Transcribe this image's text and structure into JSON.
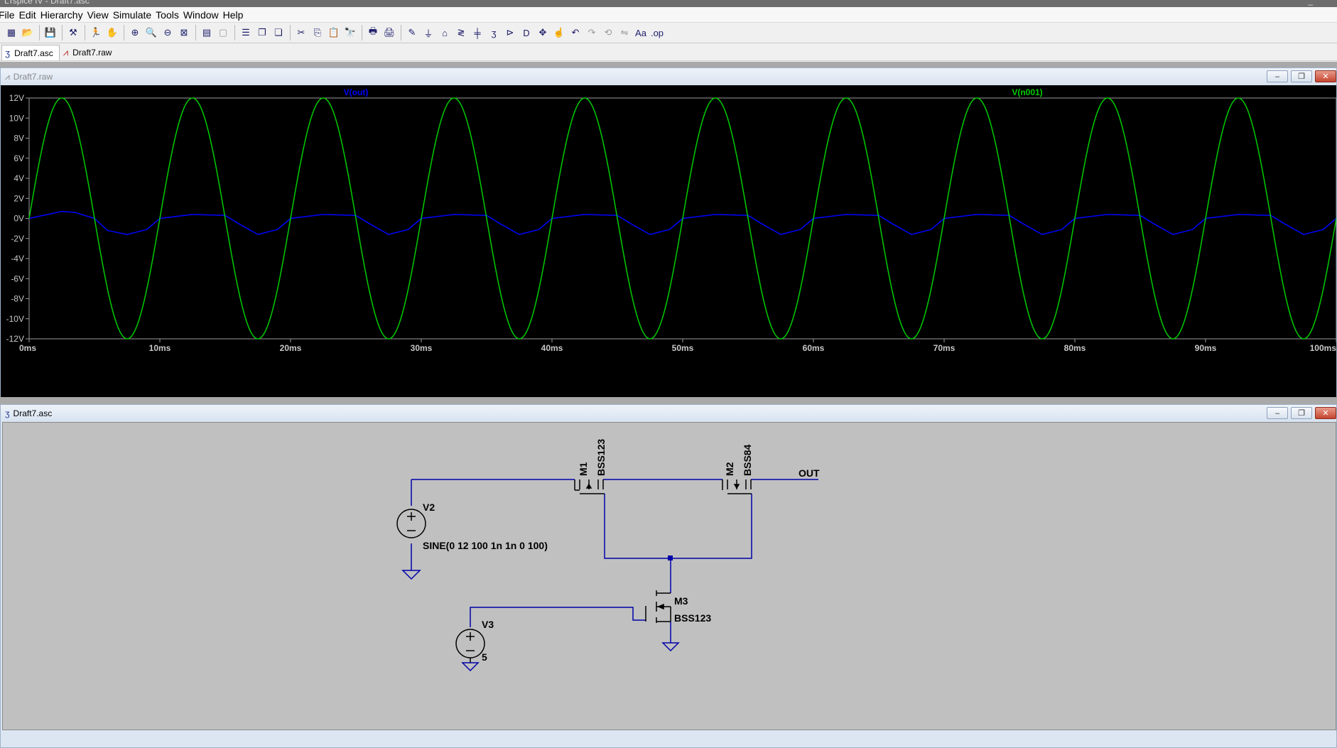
{
  "window": {
    "title": "LTspice IV - Draft7.asc",
    "min_glyph": "_"
  },
  "menu": [
    {
      "label": "File"
    },
    {
      "label": "Edit"
    },
    {
      "label": "Hierarchy"
    },
    {
      "label": "View"
    },
    {
      "label": "Simulate"
    },
    {
      "label": "Tools"
    },
    {
      "label": "Window"
    },
    {
      "label": "Help"
    }
  ],
  "toolbar": [
    {
      "icon": "new-schematic-icon",
      "glyph": "▦"
    },
    {
      "icon": "open-icon",
      "glyph": "📂"
    },
    {
      "sep": true
    },
    {
      "icon": "save-icon",
      "glyph": "💾"
    },
    {
      "sep": true
    },
    {
      "icon": "control-panel-icon",
      "glyph": "⚒"
    },
    {
      "sep": true
    },
    {
      "icon": "run-icon",
      "glyph": "🏃"
    },
    {
      "icon": "halt-icon",
      "glyph": "✋",
      "dim": true
    },
    {
      "sep": true
    },
    {
      "icon": "zoom-in-icon",
      "glyph": "⊕"
    },
    {
      "icon": "pan-icon",
      "glyph": "🔍"
    },
    {
      "icon": "zoom-out-icon",
      "glyph": "⊖"
    },
    {
      "icon": "zoom-fit-icon",
      "glyph": "⊠"
    },
    {
      "sep": true
    },
    {
      "icon": "autorange-icon",
      "glyph": "▤"
    },
    {
      "icon": "delete-traces-icon",
      "glyph": "▢",
      "dim": true
    },
    {
      "sep": true
    },
    {
      "icon": "tile-vertical-icon",
      "glyph": "☰"
    },
    {
      "icon": "cascade-icon",
      "glyph": "❐"
    },
    {
      "icon": "tile-horizontal-icon",
      "glyph": "❏"
    },
    {
      "sep": true
    },
    {
      "icon": "cut-icon",
      "glyph": "✂"
    },
    {
      "icon": "copy-icon",
      "glyph": "⎘"
    },
    {
      "icon": "paste-icon",
      "glyph": "📋"
    },
    {
      "icon": "find-icon",
      "glyph": "🔭"
    },
    {
      "sep": true
    },
    {
      "icon": "print-setup-icon",
      "glyph": "🖶"
    },
    {
      "icon": "print-icon",
      "glyph": "🖨"
    },
    {
      "sep": true
    },
    {
      "icon": "wire-icon",
      "glyph": "✎"
    },
    {
      "icon": "ground-icon",
      "glyph": "⏚"
    },
    {
      "icon": "label-net-icon",
      "glyph": "⌂"
    },
    {
      "icon": "resistor-icon",
      "glyph": "≷"
    },
    {
      "icon": "capacitor-icon",
      "glyph": "╪"
    },
    {
      "icon": "inductor-icon",
      "glyph": "ʒ"
    },
    {
      "icon": "diode-icon",
      "glyph": "⊳"
    },
    {
      "icon": "component-icon",
      "glyph": "D"
    },
    {
      "icon": "move-icon",
      "glyph": "✥"
    },
    {
      "icon": "drag-icon",
      "glyph": "☝"
    },
    {
      "icon": "undo-icon",
      "glyph": "↶"
    },
    {
      "icon": "redo-icon",
      "glyph": "↷",
      "dim": true
    },
    {
      "icon": "rotate-icon",
      "glyph": "⟲",
      "dim": true
    },
    {
      "icon": "mirror-icon",
      "glyph": "⇋",
      "dim": true
    },
    {
      "icon": "text-icon",
      "glyph": "Aa"
    },
    {
      "icon": "spice-directive-icon",
      "glyph": ".op"
    }
  ],
  "tabs": [
    {
      "label": "Draft7.asc",
      "icon": "schematic-icon",
      "glyph": "ʒ",
      "active": true
    },
    {
      "label": "Draft7.raw",
      "icon": "waveform-icon",
      "glyph": "⩘",
      "active": false
    }
  ],
  "plot_window": {
    "title": "Draft7.raw"
  },
  "schematic_window": {
    "title": "Draft7.asc"
  },
  "window_buttons": {
    "minimize": "–",
    "restore": "❐",
    "close": "✕"
  },
  "chart_data": {
    "type": "line",
    "title": "",
    "x_unit": "ms",
    "xlim": [
      0,
      100
    ],
    "ylim": [
      -12,
      12
    ],
    "x_ticks": [
      "0ms",
      "10ms",
      "20ms",
      "30ms",
      "40ms",
      "50ms",
      "60ms",
      "70ms",
      "80ms",
      "90ms",
      "100ms"
    ],
    "y_ticks": [
      "12V",
      "10V",
      "8V",
      "6V",
      "4V",
      "2V",
      "0V",
      "-2V",
      "-4V",
      "-6V",
      "-8V",
      "-10V",
      "-12V"
    ],
    "grid": false,
    "background": "#000000",
    "series": [
      {
        "name": "V(out)",
        "color": "#0000ff",
        "x": [
          0,
          2.5,
          3.5,
          5,
          6,
          7.5,
          9,
          10,
          12.5,
          15,
          16,
          17.5,
          19,
          20,
          22.5,
          25,
          26,
          27.5,
          29,
          30,
          32.5,
          35,
          36,
          37.5,
          39,
          40,
          42.5,
          45,
          46,
          47.5,
          49,
          50,
          52.5,
          55,
          56,
          57.5,
          59,
          60,
          62.5,
          65,
          66,
          67.5,
          69,
          70,
          72.5,
          75,
          76,
          77.5,
          79,
          80,
          82.5,
          85,
          86,
          87.5,
          89,
          90,
          92.5,
          95,
          96,
          97.5,
          99,
          100
        ],
        "y": [
          0,
          0.7,
          0.6,
          0,
          -1.2,
          -1.6,
          -1.1,
          0,
          0.4,
          0.3,
          -0.5,
          -1.6,
          -1.1,
          0,
          0.4,
          0.3,
          -0.5,
          -1.6,
          -1.1,
          0,
          0.4,
          0.3,
          -0.5,
          -1.6,
          -1.1,
          0,
          0.4,
          0.3,
          -0.5,
          -1.6,
          -1.1,
          0,
          0.4,
          0.3,
          -0.5,
          -1.6,
          -1.1,
          0,
          0.4,
          0.3,
          -0.5,
          -1.6,
          -1.1,
          0,
          0.4,
          0.3,
          -0.5,
          -1.6,
          -1.1,
          0,
          0.4,
          0.3,
          -0.5,
          -1.6,
          -1.1,
          0,
          0.4,
          0.3,
          -0.5,
          -1.6,
          -1.1,
          0
        ]
      },
      {
        "name": "V(n001)",
        "color": "#00cc00",
        "function": "12*sin(2*pi*100*t)",
        "amplitude": 12,
        "frequency_hz": 100,
        "x": [
          0,
          2.5,
          5,
          7.5,
          10,
          12.5,
          15,
          17.5,
          20,
          22.5,
          25,
          27.5,
          30,
          32.5,
          35,
          37.5,
          40,
          42.5,
          45,
          47.5,
          50,
          52.5,
          55,
          57.5,
          60,
          62.5,
          65,
          67.5,
          70,
          72.5,
          75,
          77.5,
          80,
          82.5,
          85,
          87.5,
          90,
          92.5,
          95,
          97.5,
          100
        ],
        "y": [
          0,
          12,
          0,
          -12,
          0,
          12,
          0,
          -12,
          0,
          12,
          0,
          -12,
          0,
          12,
          0,
          -12,
          0,
          12,
          0,
          -12,
          0,
          12,
          0,
          -12,
          0,
          12,
          0,
          -12,
          0,
          12,
          0,
          -12,
          0,
          12,
          0,
          -12,
          0,
          12,
          0,
          -12,
          0
        ]
      }
    ]
  },
  "schematic": {
    "wire_color": "#0000aa",
    "components": {
      "M1": {
        "ref": "M1",
        "model": "BSS123"
      },
      "M2": {
        "ref": "M2",
        "model": "BSS84"
      },
      "M3": {
        "ref": "M3",
        "model": "BSS123"
      },
      "V2": {
        "ref": "V2",
        "value": "SINE(0 12 100 1n 1n 0 100)"
      },
      "V3": {
        "ref": "V3",
        "value": "5"
      }
    },
    "net_label": "OUT"
  }
}
